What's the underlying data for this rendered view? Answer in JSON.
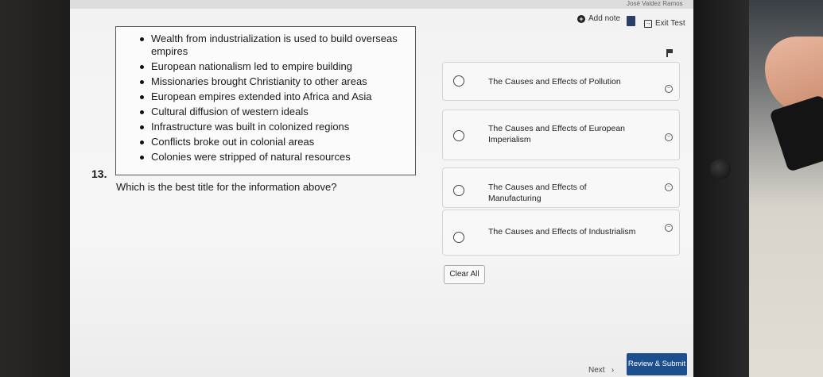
{
  "header": {
    "user_name": "José Valdez Ramos",
    "add_note_label": "Add note",
    "exit_test_label": "Exit Test"
  },
  "passage": {
    "bullets": [
      "Wealth from industrialization is used to build overseas empires",
      "European nationalism led to empire building",
      "Missionaries brought Christianity to other areas",
      "European empires extended into Africa and Asia",
      "Cultural diffusion of western ideals",
      "Infrastructure was built in colonized regions",
      "Conflicts broke out in colonial areas",
      "Colonies were stripped of natural resources"
    ]
  },
  "question": {
    "number": "13.",
    "text": "Which is the best title for the information above?"
  },
  "choices": [
    {
      "label": "The Causes and Effects of Pollution"
    },
    {
      "label": "The Causes and Effects of European Imperialism"
    },
    {
      "label": "The Causes and Effects of Manufacturing"
    },
    {
      "label": "The Causes and Effects of Industrialism"
    }
  ],
  "footer": {
    "clear_all_label": "Clear All",
    "next_label": "Next",
    "submit_label": "Review & Submit"
  },
  "icons": {
    "add_note": "plus-circle-icon",
    "bookmark": "bookmark-icon",
    "exit": "exit-icon",
    "flag": "flag-icon",
    "eliminate": "eliminate-icon"
  },
  "colors": {
    "submit_bg": "#1d4f8f",
    "bookmark": "#2a3f66"
  }
}
